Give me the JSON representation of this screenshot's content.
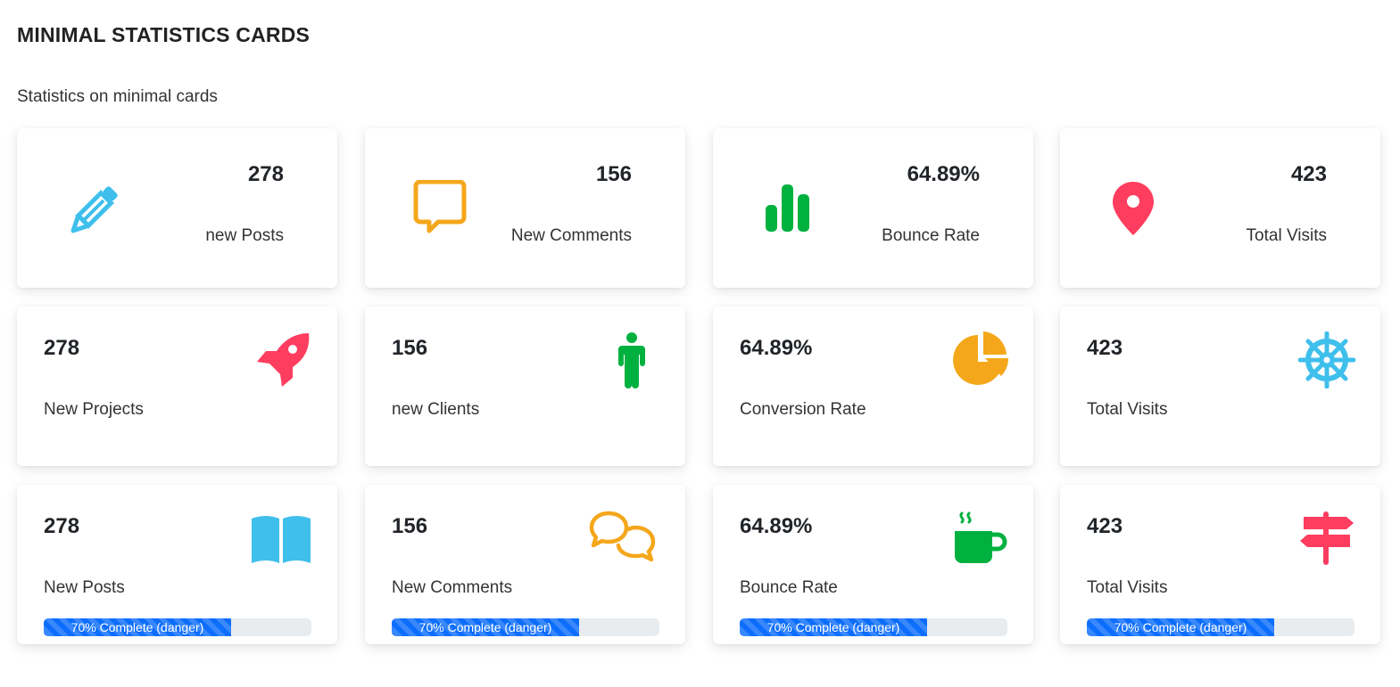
{
  "page": {
    "title": "MINIMAL STATISTICS CARDS",
    "subtitle": "Statistics on minimal cards"
  },
  "colors": {
    "blue": "#3fbfec",
    "orange": "#f4a71b",
    "green": "#00b140",
    "red": "#ff3d5f",
    "progress": "#0d6efd"
  },
  "row1": [
    {
      "value": "278",
      "label": "new Posts",
      "icon": "pencil-icon",
      "color": "#3fbfec"
    },
    {
      "value": "156",
      "label": "New Comments",
      "icon": "speech-bubble-icon",
      "color": "#f4a71b"
    },
    {
      "value": "64.89%",
      "label": "Bounce Rate",
      "icon": "bar-chart-icon",
      "color": "#00b140"
    },
    {
      "value": "423",
      "label": "Total Visits",
      "icon": "map-pin-icon",
      "color": "#ff3d5f"
    }
  ],
  "row2": [
    {
      "value": "278",
      "label": "New Projects",
      "icon": "rocket-icon",
      "color": "#ff3d5f"
    },
    {
      "value": "156",
      "label": "new Clients",
      "icon": "person-icon",
      "color": "#00b140"
    },
    {
      "value": "64.89%",
      "label": "Conversion Rate",
      "icon": "pie-chart-icon",
      "color": "#f4a71b"
    },
    {
      "value": "423",
      "label": "Total Visits",
      "icon": "ship-wheel-icon",
      "color": "#3fbfec"
    }
  ],
  "row3": [
    {
      "value": "278",
      "label": "New Posts",
      "icon": "book-icon",
      "color": "#3fbfec",
      "progress_text": "70% Complete (danger)",
      "progress": 70
    },
    {
      "value": "156",
      "label": "New Comments",
      "icon": "chat-bubbles-icon",
      "color": "#f4a71b",
      "progress_text": "70% Complete (danger)",
      "progress": 70
    },
    {
      "value": "64.89%",
      "label": "Bounce Rate",
      "icon": "coffee-cup-icon",
      "color": "#00b140",
      "progress_text": "70% Complete (danger)",
      "progress": 70
    },
    {
      "value": "423",
      "label": "Total Visits",
      "icon": "signpost-icon",
      "color": "#ff3d5f",
      "progress_text": "70% Complete (danger)",
      "progress": 70
    }
  ]
}
